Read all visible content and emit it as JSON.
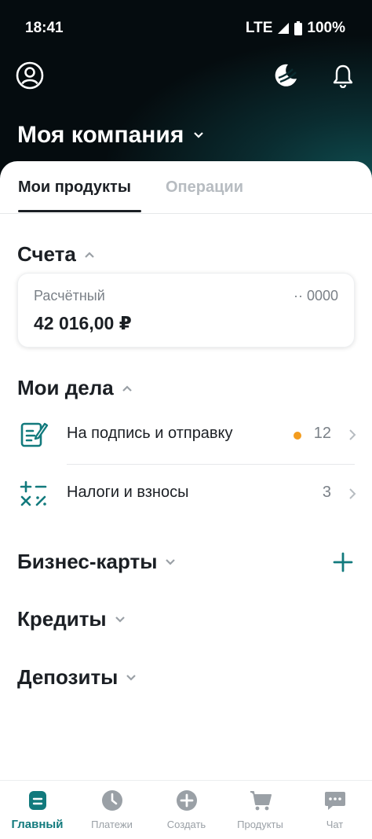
{
  "status_bar": {
    "time": "18:41",
    "network": "LTE",
    "battery": "100%"
  },
  "header": {
    "company_name": "Моя компания"
  },
  "tabs": [
    {
      "label": "Мои продукты",
      "active": true
    },
    {
      "label": "Операции",
      "active": false
    }
  ],
  "accounts": {
    "title": "Счета",
    "card": {
      "type": "Расчётный",
      "number": "·· 0000",
      "balance": "42 016,00 ₽"
    }
  },
  "tasks": {
    "title": "Мои дела",
    "items": [
      {
        "label": "На подпись и отправку",
        "count": "12",
        "icon": "document-sign-icon",
        "has_dot": true
      },
      {
        "label": "Налоги и взносы",
        "count": "3",
        "icon": "calculator-icon",
        "has_dot": false
      }
    ]
  },
  "sections": [
    {
      "title": "Бизнес-карты",
      "has_add": true
    },
    {
      "title": "Кредиты",
      "has_add": false
    },
    {
      "title": "Депозиты",
      "has_add": false
    }
  ],
  "bottom_nav": [
    {
      "label": "Главный",
      "icon": "home-document-icon",
      "active": true
    },
    {
      "label": "Платежи",
      "icon": "clock-icon",
      "active": false
    },
    {
      "label": "Создать",
      "icon": "plus-circle-icon",
      "active": false
    },
    {
      "label": "Продукты",
      "icon": "cart-icon",
      "active": false
    },
    {
      "label": "Чат",
      "icon": "chat-icon",
      "active": false
    }
  ],
  "colors": {
    "accent": "#127a7d",
    "dot": "#f39c1e",
    "text": "#1b1f24",
    "muted": "#7a8087"
  }
}
